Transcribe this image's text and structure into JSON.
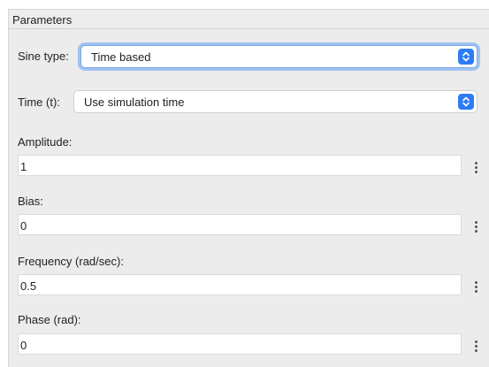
{
  "panel": {
    "title": "Parameters"
  },
  "sine_type": {
    "label": "Sine type:",
    "value": "Time based"
  },
  "time": {
    "label": "Time (t):",
    "value": "Use simulation time"
  },
  "amplitude": {
    "label": "Amplitude:",
    "value": "1"
  },
  "bias": {
    "label": "Bias:",
    "value": "0"
  },
  "frequency": {
    "label": "Frequency (rad/sec):",
    "value": "0.5"
  },
  "phase": {
    "label": "Phase (rad):",
    "value": "0"
  },
  "icons": {
    "select_stepper": "up-down-chevron-icon",
    "field_menu": "vertical-ellipsis-icon"
  },
  "colors": {
    "accent": "#2d7cf6",
    "focus_ring": "#9fc3f3",
    "panel_bg": "#ececec"
  }
}
